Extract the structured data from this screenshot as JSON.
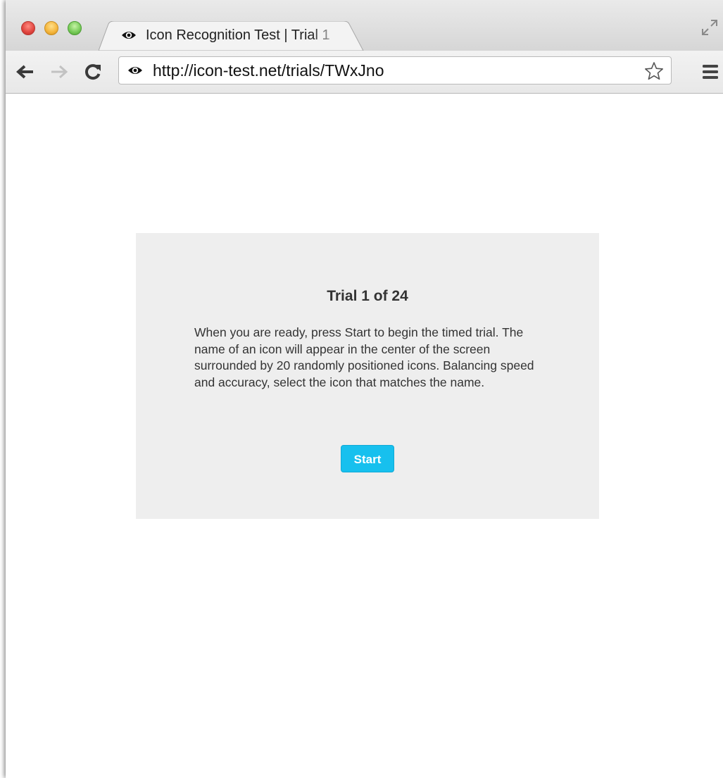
{
  "browser": {
    "tab": {
      "title": "Icon Recognition Test | Trial 1",
      "icon": "eye-icon"
    },
    "address_bar": {
      "url": "http://icon-test.net/trials/TWxJno",
      "icon": "eye-icon"
    },
    "toolbar_icons": [
      "back-arrow-icon",
      "forward-arrow-icon",
      "reload-icon",
      "star-icon",
      "menu-icon"
    ],
    "window_controls": [
      "close",
      "minimize",
      "zoom"
    ]
  },
  "trial": {
    "heading": "Trial 1 of 24",
    "instructions": "When you are ready, press Start to begin the timed trial. The name of an icon will appear in the center of the screen surrounded by 20 randomly positioned icons. Balancing speed and accuracy, select the icon that matches the name.",
    "start_label": "Start"
  },
  "colors": {
    "start_button": "#17c0ee",
    "card_background": "#eeeeee"
  }
}
